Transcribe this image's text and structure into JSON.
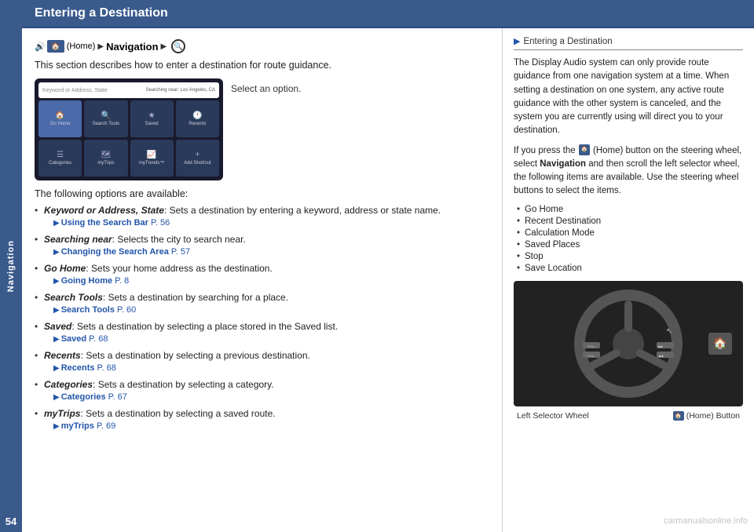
{
  "header": {
    "title": "Entering a Destination"
  },
  "sidebar": {
    "label": "Navigation"
  },
  "page_number": "54",
  "breadcrumb": {
    "home_label": "Home",
    "nav_label": "Navigation"
  },
  "intro": {
    "text": "This section describes how to enter a destination for route guidance."
  },
  "screenshot": {
    "select_option": "Select an option.",
    "search_placeholder": "Keyword or Address, State",
    "search_near": "Searching near: Los Angeles, CA",
    "cells": [
      {
        "icon": "🏠",
        "label": "Go Home"
      },
      {
        "icon": "🔍",
        "label": "Search Tools"
      },
      {
        "icon": "★",
        "label": "Saved"
      },
      {
        "icon": "🕐",
        "label": "Recents"
      },
      {
        "icon": "☰",
        "label": "Categories"
      },
      {
        "icon": "🗺",
        "label": "myTrips"
      },
      {
        "icon": "📈",
        "label": "myTrends™"
      },
      {
        "icon": "+",
        "label": "Add Shortcut"
      }
    ]
  },
  "options_intro": "The following options are available:",
  "options": [
    {
      "term": "Keyword or Address, State",
      "desc": ": Sets a destination by entering a keyword, address or state name.",
      "ref_text": "Using the Search Bar",
      "ref_page": "P. 56"
    },
    {
      "term": "Searching near",
      "desc": ": Selects the city to search near.",
      "ref_text": "Changing the Search Area",
      "ref_page": "P. 57"
    },
    {
      "term": "Go Home",
      "desc": ": Sets your home address as the destination.",
      "ref_text": "Going Home",
      "ref_page": "P. 8"
    },
    {
      "term": "Search Tools",
      "desc": ": Sets a destination by searching for a place.",
      "ref_text": "Search Tools",
      "ref_page": "P. 60"
    },
    {
      "term": "Saved",
      "desc": ": Sets a destination by selecting a place stored in the Saved list.",
      "ref_text": "Saved",
      "ref_page": "P. 68"
    },
    {
      "term": "Recents",
      "desc": ": Sets a destination by selecting a previous destination.",
      "ref_text": "Recents",
      "ref_page": "P. 68"
    },
    {
      "term": "Categories",
      "desc": ": Sets a destination by selecting a category.",
      "ref_text": "Categories",
      "ref_page": "P. 67"
    },
    {
      "term": "myTrips",
      "desc": ": Sets a destination by selecting a saved route.",
      "ref_text": "myTrips",
      "ref_page": "P. 69"
    }
  ],
  "right_column": {
    "section_title": "Entering a Destination",
    "para1": "The Display Audio system can only provide route guidance from one navigation system at a time. When setting a destination on one system, any active route guidance with the other system is canceled, and the system you are currently using will direct you to your destination.",
    "para2_before": "If you press the",
    "para2_home": "(Home) button on the steering wheel, select",
    "para2_nav": "Navigation",
    "para2_after": "and then scroll the left selector wheel, the following items are available. Use the steering wheel buttons to select the items.",
    "list_items": [
      "Go Home",
      "Recent Destination",
      "Calculation Mode",
      "Saved Places",
      "Stop",
      "Save Location"
    ],
    "caption_left": "Left Selector Wheel",
    "caption_right_prefix": "(Home) Button"
  },
  "watermark": "carmanualsonline.info"
}
